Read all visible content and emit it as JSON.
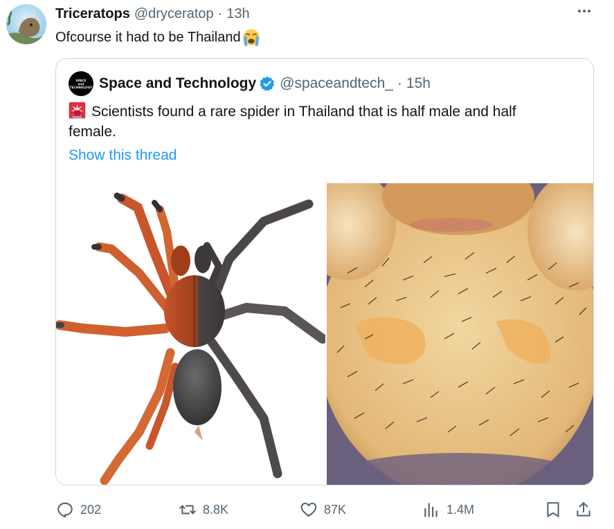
{
  "tweet": {
    "display_name": "Triceratops",
    "handle": "@dryceratop",
    "separator": "·",
    "time": "13h",
    "text": "Ofcourse it had to be Thailand",
    "emoji": "loudly-crying-face"
  },
  "quote": {
    "avatar_text_1": "SPACE",
    "avatar_text_2": "and",
    "avatar_text_3": "TECHNOLOGY",
    "display_name": "Space and Technology",
    "verified": true,
    "handle": "@spaceandtech_",
    "separator": "·",
    "time": "15h",
    "text": "Scientists found a rare spider in Thailand that is half male and half female.",
    "emoji": "police-light",
    "show_thread": "Show this thread",
    "media": [
      {
        "kind": "photo",
        "subject": "spider-half-orange-half-gray"
      },
      {
        "kind": "photo",
        "subject": "spider-closeup-hairy-underside"
      }
    ]
  },
  "actions": {
    "replies": "202",
    "reposts": "8.8K",
    "likes": "87K",
    "views": "1.4M"
  },
  "colors": {
    "accent": "#1d9bf0",
    "text": "#0f1419",
    "secondary": "#536471",
    "border": "#cfd9de"
  }
}
